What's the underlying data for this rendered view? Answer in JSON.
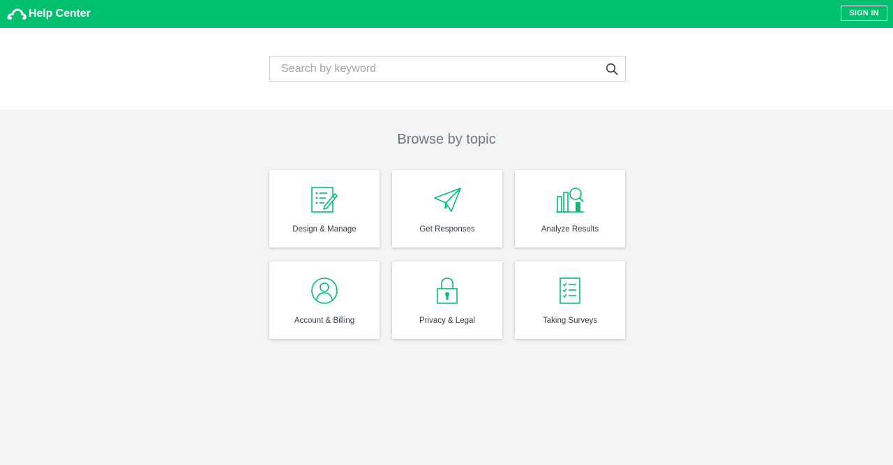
{
  "header": {
    "brand_label": "Help Center",
    "brand_icon": "cloud-logo-icon",
    "signin_label": "SIGN IN",
    "accent_color": "#00bf6f"
  },
  "search": {
    "placeholder": "Search by keyword",
    "value": "",
    "icon": "search-icon"
  },
  "browse": {
    "title": "Browse by topic",
    "topics": [
      {
        "label": "Design & Manage",
        "icon": "survey-edit-icon"
      },
      {
        "label": "Get Responses",
        "icon": "paper-plane-icon"
      },
      {
        "label": "Analyze Results",
        "icon": "bar-chart-magnifier-icon"
      },
      {
        "label": "Account & Billing",
        "icon": "user-profile-icon"
      },
      {
        "label": "Privacy & Legal",
        "icon": "padlock-icon"
      },
      {
        "label": "Taking Surveys",
        "icon": "checklist-icon"
      }
    ]
  }
}
